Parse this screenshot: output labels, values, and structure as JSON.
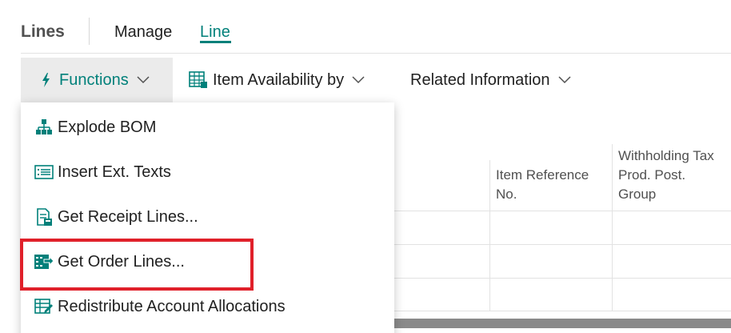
{
  "header": {
    "title": "Lines",
    "tabs": [
      {
        "label": "Manage"
      },
      {
        "label": "Line"
      }
    ]
  },
  "actions": {
    "functions_label": "Functions",
    "item_availability_label": "Item Availability by",
    "related_information_label": "Related Information"
  },
  "table": {
    "columns": [
      "Item Reference No.",
      "Withholding Tax Prod. Post. Group"
    ]
  },
  "menu": {
    "items": [
      {
        "label": "Explode BOM",
        "icon": "explode-bom-icon"
      },
      {
        "label": "Insert Ext. Texts",
        "icon": "text-list-icon"
      },
      {
        "label": "Get Receipt Lines...",
        "icon": "receipt-icon"
      },
      {
        "label": "Get Order Lines...",
        "icon": "order-lines-icon"
      },
      {
        "label": "Redistribute Account Allocations",
        "icon": "allocation-edit-icon"
      }
    ]
  },
  "colors": {
    "accent": "#00807a",
    "highlight": "#e0202a"
  }
}
